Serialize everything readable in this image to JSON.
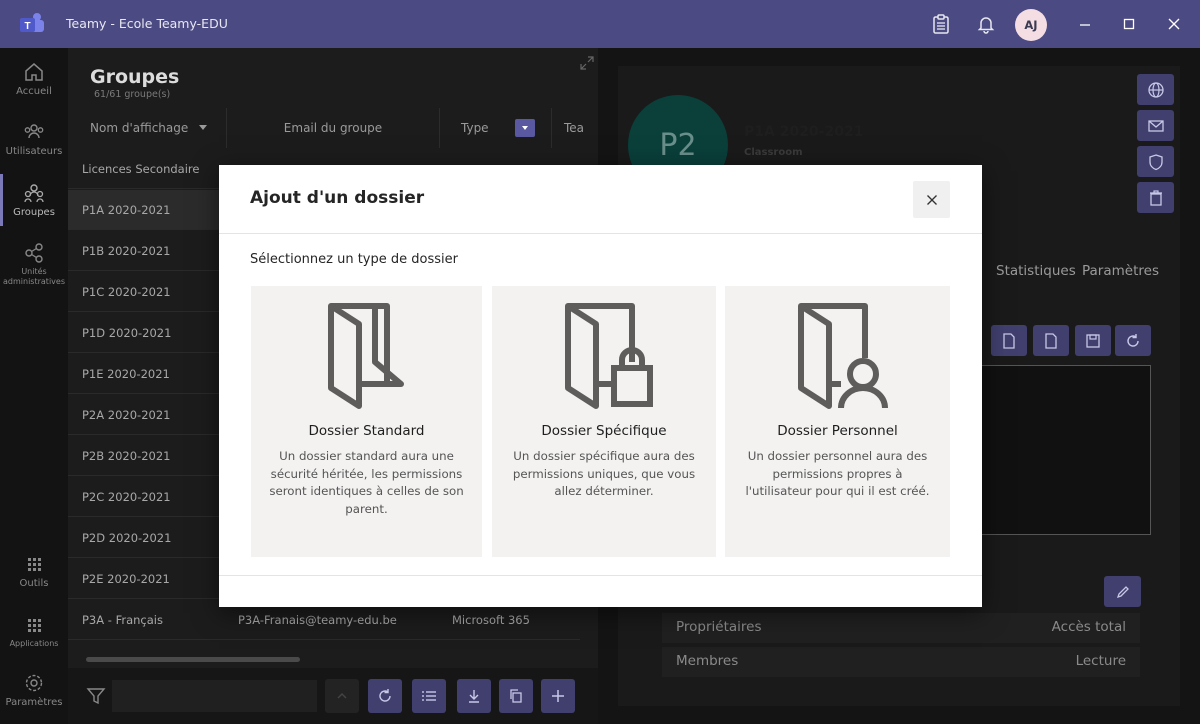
{
  "window": {
    "title": "Teamy - Ecole Teamy-EDU",
    "avatar_initials": "AJ"
  },
  "rail": {
    "items": [
      {
        "label": "Accueil"
      },
      {
        "label": "Utilisateurs"
      },
      {
        "label": "Groupes"
      },
      {
        "label": "Unités administratives"
      },
      {
        "label": "Outils"
      },
      {
        "label": "Applications"
      },
      {
        "label": "Paramètres"
      }
    ]
  },
  "groups": {
    "title": "Groupes",
    "count": "61/61 groupe(s)",
    "columns": [
      "Nom d'affichage",
      "Email du groupe",
      "Type",
      "Tea"
    ],
    "rows": [
      {
        "name": "Licences Secondaire",
        "email": "",
        "type": ""
      },
      {
        "name": "P1A 2020-2021",
        "email": "",
        "type": ""
      },
      {
        "name": "P1B 2020-2021",
        "email": "",
        "type": ""
      },
      {
        "name": "P1C 2020-2021",
        "email": "",
        "type": ""
      },
      {
        "name": "P1D 2020-2021",
        "email": "",
        "type": ""
      },
      {
        "name": "P1E 2020-2021",
        "email": "",
        "type": ""
      },
      {
        "name": "P2A 2020-2021",
        "email": "",
        "type": ""
      },
      {
        "name": "P2B 2020-2021",
        "email": "",
        "type": ""
      },
      {
        "name": "P2C 2020-2021",
        "email": "",
        "type": ""
      },
      {
        "name": "P2D 2020-2021",
        "email": "",
        "type": ""
      },
      {
        "name": "P2E 2020-2021",
        "email": "",
        "type": ""
      },
      {
        "name": "P3A - Français",
        "email": "P3A-Franais@teamy-edu.be",
        "type": "Microsoft 365"
      }
    ]
  },
  "details": {
    "avatar": "P2",
    "name": "P1A 2020-2021",
    "kind": "Classroom",
    "tabs": [
      "Statistiques",
      "Paramètres"
    ],
    "permissions": [
      {
        "role": "Propriétaires",
        "access": "Accès total"
      },
      {
        "role": "Membres",
        "access": "Lecture"
      }
    ]
  },
  "modal": {
    "title": "Ajout d'un dossier",
    "subtitle": "Sélectionnez un type de dossier",
    "options": [
      {
        "title": "Dossier Standard",
        "description": "Un dossier standard aura une sécurité héritée, les permissions seront identiques à celles de son parent."
      },
      {
        "title": "Dossier Spécifique",
        "description": "Un dossier spécifique aura des permissions uniques, que vous allez déterminer."
      },
      {
        "title": "Dossier Personnel",
        "description": "Un dossier personnel aura des permissions propres à l'utilisateur pour qui il est créé."
      }
    ]
  },
  "colors": {
    "accent": "#4b4a82",
    "button": "#403f6e"
  }
}
